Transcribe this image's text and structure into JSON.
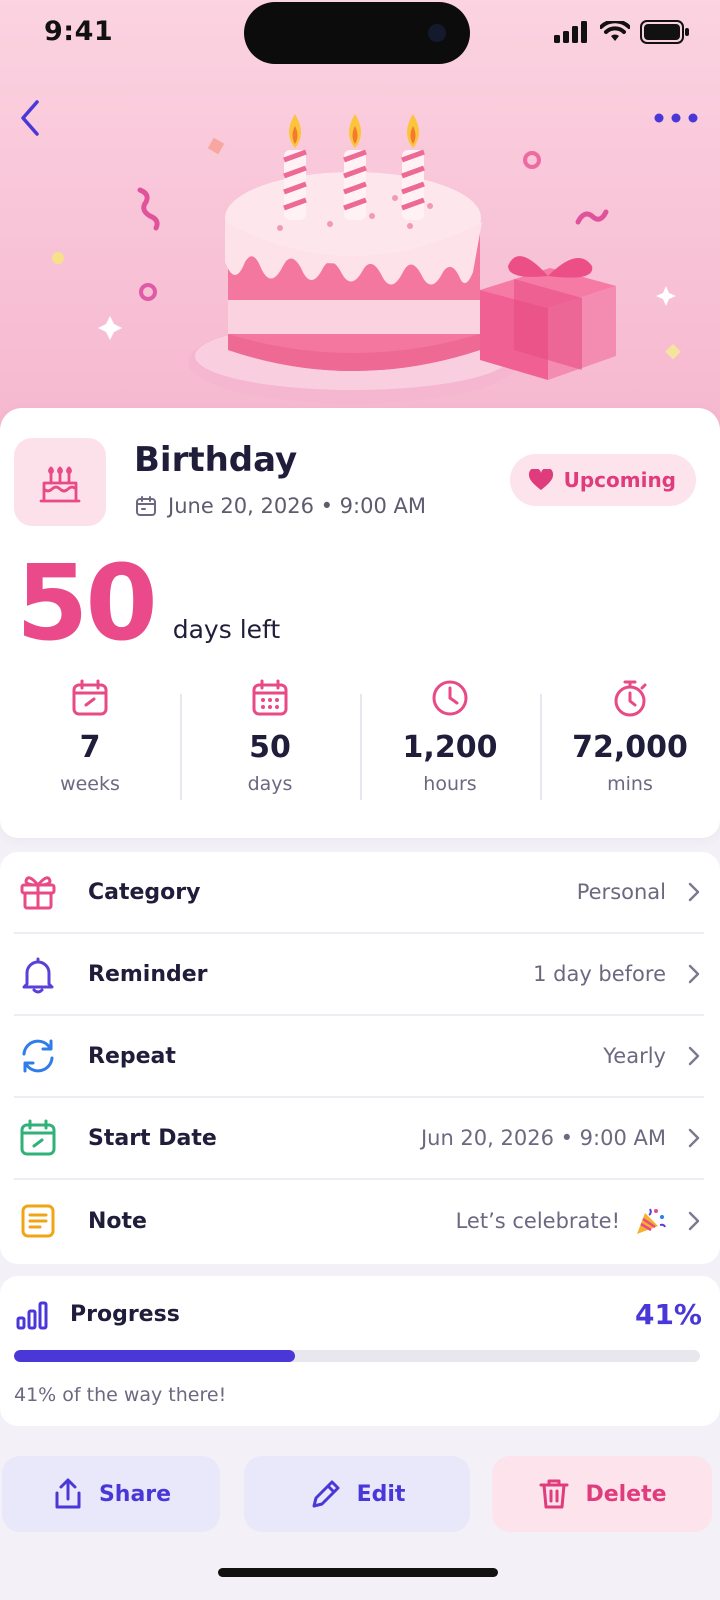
{
  "status_bar": {
    "time": "9:41"
  },
  "event": {
    "title": "Birthday",
    "date_time": "June 20, 2026 • 9:00 AM",
    "status_badge": "Upcoming",
    "count": "50",
    "count_label": "days left"
  },
  "stats": [
    {
      "value": "7",
      "unit": "weeks",
      "icon": "calendar-icon"
    },
    {
      "value": "50",
      "unit": "days",
      "icon": "calendar-grid-icon"
    },
    {
      "value": "1,200",
      "unit": "hours",
      "icon": "clock-icon"
    },
    {
      "value": "72,000",
      "unit": "mins",
      "icon": "stopwatch-icon"
    }
  ],
  "details": [
    {
      "label": "Category",
      "value": "Personal",
      "icon": "gift-icon",
      "color": "#e84a86"
    },
    {
      "label": "Reminder",
      "value": "1 day before",
      "icon": "bell-icon",
      "color": "#5b3fd9"
    },
    {
      "label": "Repeat",
      "value": "Yearly",
      "icon": "repeat-icon",
      "color": "#2f7de8"
    },
    {
      "label": "Start Date",
      "value": "Jun 20, 2026 • 9:00 AM",
      "icon": "calendar-check-icon",
      "color": "#2fb27a"
    },
    {
      "label": "Note",
      "value": "Let’s celebrate!",
      "icon": "note-icon",
      "color": "#f2a417",
      "emoji": "🎉"
    }
  ],
  "progress": {
    "title": "Progress",
    "percent_label": "41%",
    "fraction": 0.41,
    "note": "41% of the way there!"
  },
  "actions": {
    "share": "Share",
    "edit": "Edit",
    "delete": "Delete"
  },
  "colors": {
    "accent_pink": "#ea4a8a",
    "accent_indigo": "#4a37d8",
    "hero_bg": "#f8c2d6"
  }
}
